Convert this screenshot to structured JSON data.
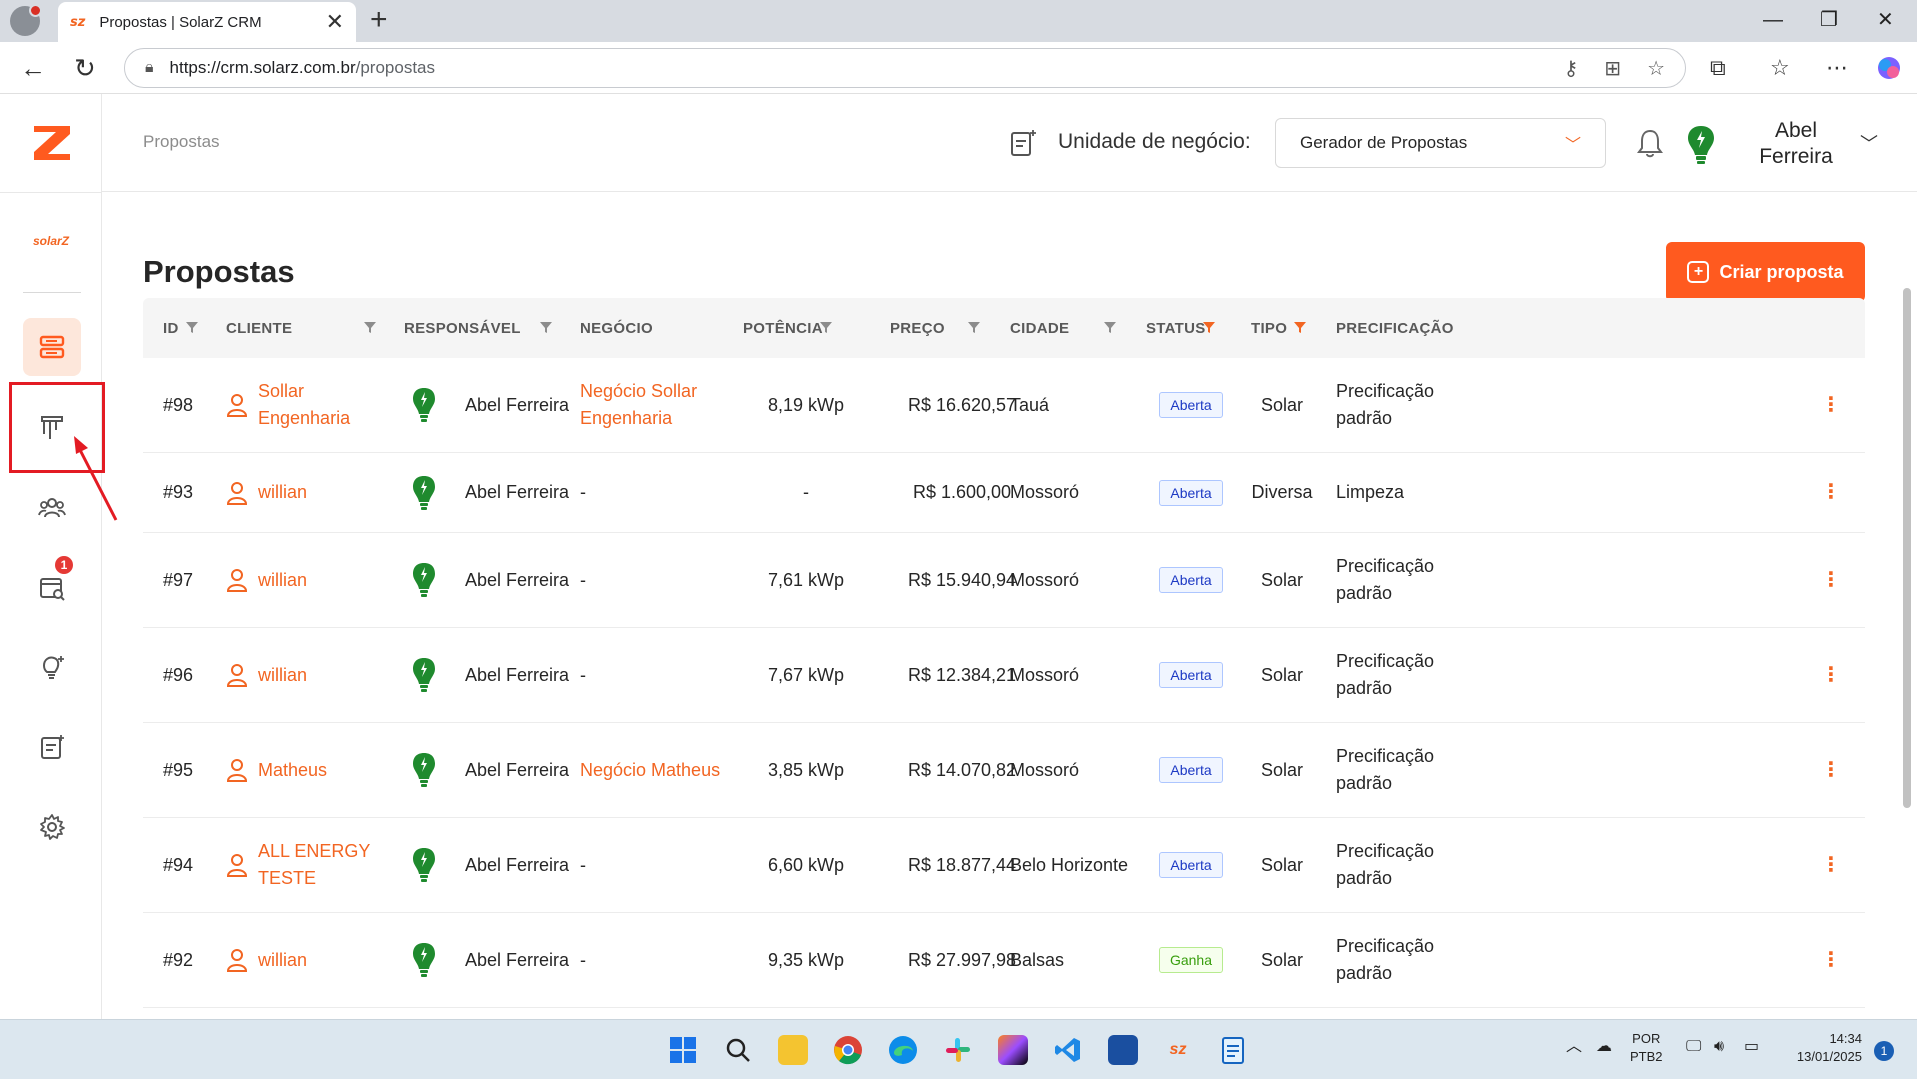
{
  "browser": {
    "tab_title": "Propostas | SolarZ CRM",
    "tab_favicon": "sz",
    "url_base": "https://crm.solarz.com.br",
    "url_path": "/propostas"
  },
  "sidebar": {
    "brand_small": "solarZ",
    "notification_count": "1"
  },
  "header": {
    "breadcrumb": "Propostas",
    "unit_label": "Unidade de negócio:",
    "unit_value": "Gerador de Propostas",
    "user_name": "Abel Ferreira"
  },
  "page": {
    "title": "Propostas",
    "create_button": "Criar proposta"
  },
  "table": {
    "columns": {
      "id": "ID",
      "cliente": "CLIENTE",
      "responsavel": "RESPONSÁVEL",
      "negocio": "NEGÓCIO",
      "potencia": "POTÊNCIA",
      "preco": "PREÇO",
      "cidade": "CIDADE",
      "status": "STATUS",
      "tipo": "TIPO",
      "precificacao": "PRECIFICAÇÃO"
    },
    "rows": [
      {
        "id": "#98",
        "cliente": "Sollar Engenharia",
        "responsavel": "Abel Ferreira",
        "negocio": "Negócio Sollar Engenharia",
        "potencia": "8,19 kWp",
        "preco": "R$ 16.620,57",
        "cidade": "Tauá",
        "status": "Aberta",
        "tipo": "Solar",
        "precificacao": "Precificação padrão"
      },
      {
        "id": "#93",
        "cliente": "willian",
        "responsavel": "Abel Ferreira",
        "negocio": "-",
        "potencia": "-",
        "preco": "R$ 1.600,00",
        "cidade": "Mossoró",
        "status": "Aberta",
        "tipo": "Diversa",
        "precificacao": "Limpeza"
      },
      {
        "id": "#97",
        "cliente": "willian",
        "responsavel": "Abel Ferreira",
        "negocio": "-",
        "potencia": "7,61 kWp",
        "preco": "R$ 15.940,94",
        "cidade": "Mossoró",
        "status": "Aberta",
        "tipo": "Solar",
        "precificacao": "Precificação padrão"
      },
      {
        "id": "#96",
        "cliente": "willian",
        "responsavel": "Abel Ferreira",
        "negocio": "-",
        "potencia": "7,67 kWp",
        "preco": "R$ 12.384,21",
        "cidade": "Mossoró",
        "status": "Aberta",
        "tipo": "Solar",
        "precificacao": "Precificação padrão"
      },
      {
        "id": "#95",
        "cliente": "Matheus",
        "responsavel": "Abel Ferreira",
        "negocio": "Negócio Matheus",
        "potencia": "3,85 kWp",
        "preco": "R$ 14.070,82",
        "cidade": "Mossoró",
        "status": "Aberta",
        "tipo": "Solar",
        "precificacao": "Precificação padrão"
      },
      {
        "id": "#94",
        "cliente": "ALL ENERGY TESTE",
        "responsavel": "Abel Ferreira",
        "negocio": "-",
        "potencia": "6,60 kWp",
        "preco": "R$ 18.877,44",
        "cidade": "Belo Horizonte",
        "status": "Aberta",
        "tipo": "Solar",
        "precificacao": "Precificação padrão"
      },
      {
        "id": "#92",
        "cliente": "willian",
        "responsavel": "Abel Ferreira",
        "negocio": "-",
        "potencia": "9,35 kWp",
        "preco": "R$ 27.997,98",
        "cidade": "Balsas",
        "status": "Ganha",
        "tipo": "Solar",
        "precificacao": "Precificação padrão"
      }
    ]
  },
  "taskbar": {
    "lang_line1": "POR",
    "lang_line2": "PTB2",
    "time": "14:34",
    "date": "13/01/2025",
    "notification_count": "1"
  },
  "colors": {
    "accent": "#ff5a1f",
    "brand_orange": "#f26522",
    "avatar_green": "#1f8a2e",
    "highlight_red": "#e31b23"
  }
}
